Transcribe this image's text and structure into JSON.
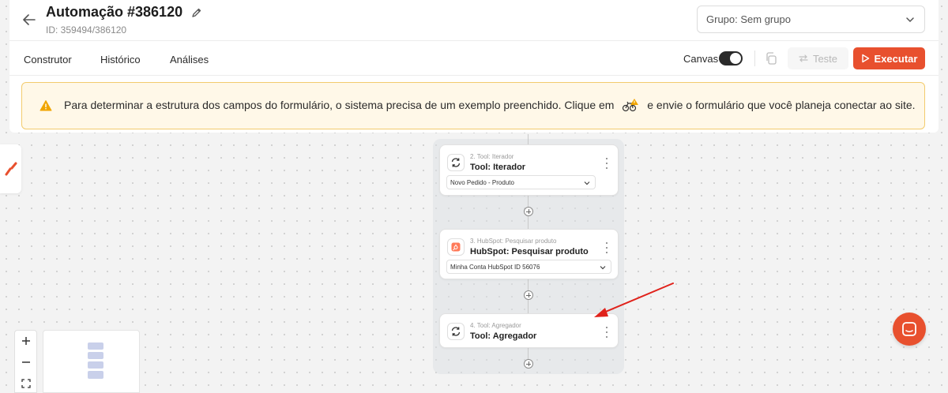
{
  "header": {
    "title": "Automação #386120",
    "id_text": "ID: 359494/386120",
    "group_select": "Grupo: Sem grupo"
  },
  "tabs": [
    {
      "label": "Construtor"
    },
    {
      "label": "Histórico"
    },
    {
      "label": "Análises"
    }
  ],
  "toolbar": {
    "canvas_label": "Canvas",
    "canvas_enabled": true,
    "test_label": "Teste",
    "run_label": "Executar"
  },
  "alert": {
    "text_before": "Para determinar a estrutura dos campos do formulário, o sistema precisa de um exemplo preenchido. Clique em",
    "text_after": "e envie o formulário que você planeja conectar ao site."
  },
  "nodes": [
    {
      "small_label": "2. Tool: Iterador",
      "title": "Tool: Iterador",
      "select_value": "Novo Pedido - Produto",
      "icon": "iterate-icon"
    },
    {
      "small_label": "3. HubSpot: Pesquisar produto",
      "title": "HubSpot: Pesquisar produto",
      "select_value": "Minha Conta HubSpot ID 56076",
      "icon": "hubspot-icon"
    },
    {
      "small_label": "4. Tool: Agregador",
      "title": "Tool: Agregador",
      "icon": "aggregate-icon"
    }
  ],
  "colors": {
    "accent": "#e8502e",
    "alert_bg": "#fff8e8",
    "alert_border": "#f3cb6d",
    "warning_icon": "#f0a500",
    "annotation_arrow": "#e0221b"
  }
}
